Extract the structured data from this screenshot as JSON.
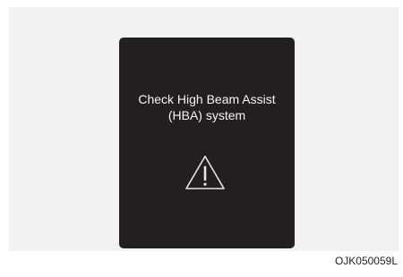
{
  "display": {
    "message_line1": "Check High Beam Assist",
    "message_line2": "(HBA) system",
    "icon": "warning-triangle-icon"
  },
  "figure_code": "OJK050059L",
  "colors": {
    "display_background": "#231f20",
    "display_text": "#f4f4f4",
    "panel_background": "#f2f2f2"
  }
}
